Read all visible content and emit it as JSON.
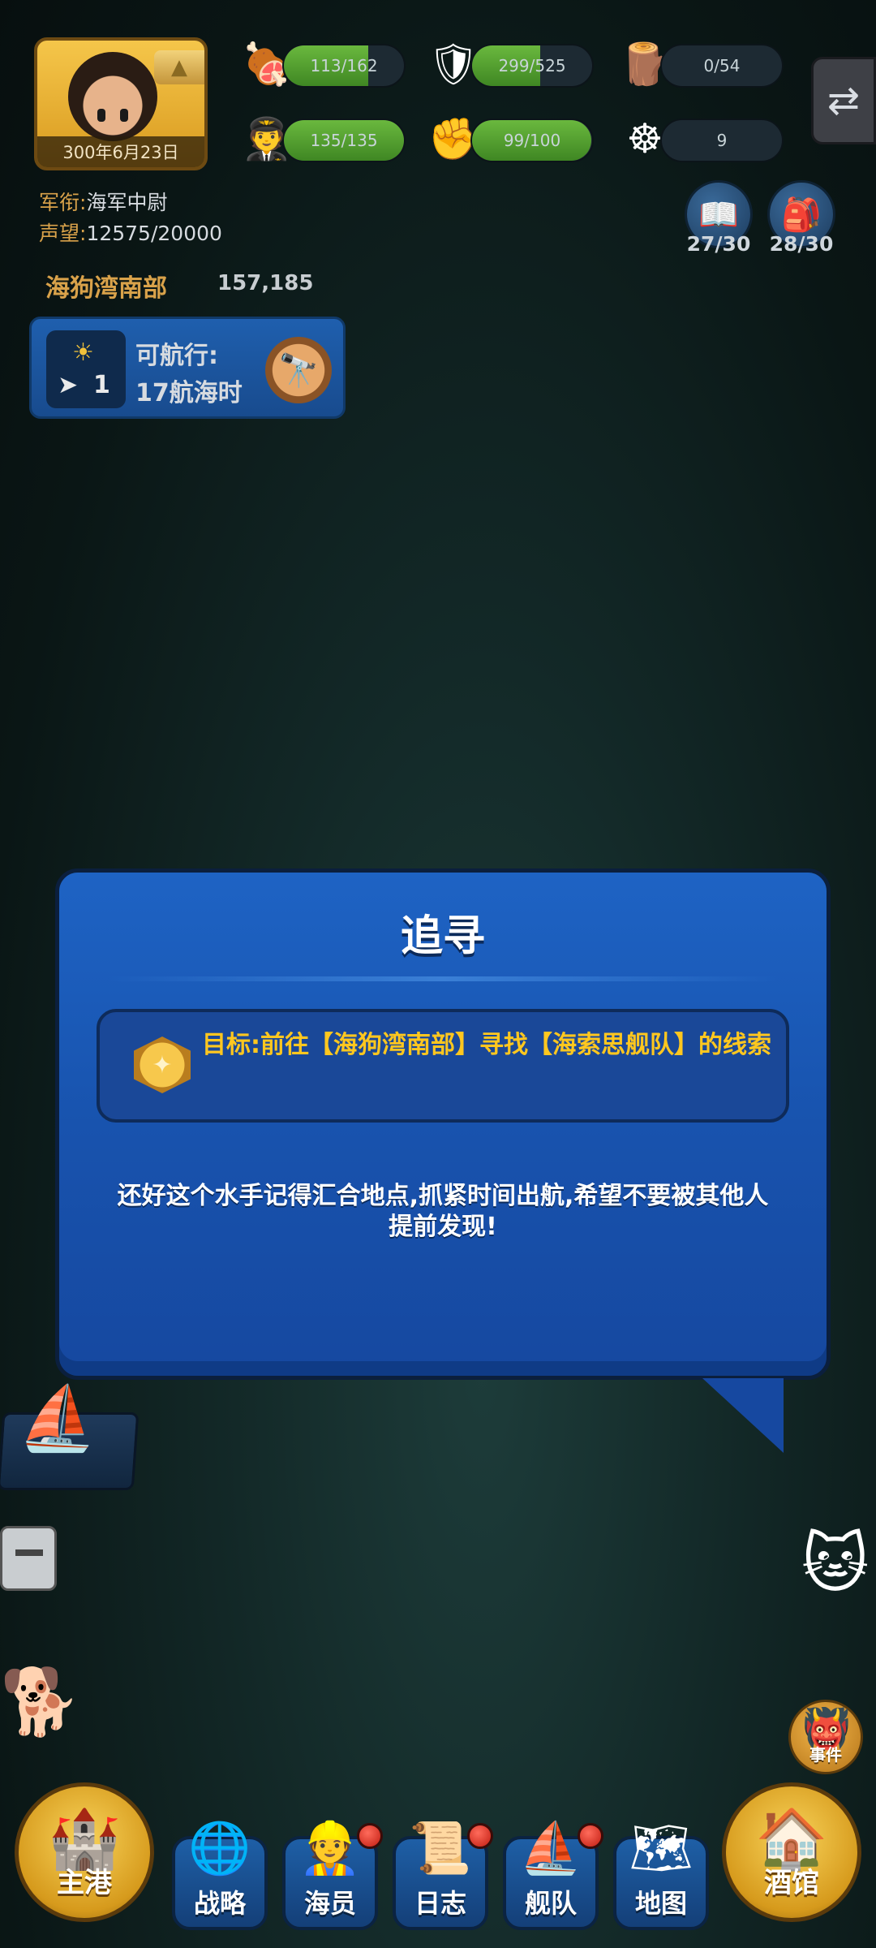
{
  "player": {
    "date": "300年6月23日",
    "rank_label": "军衔:",
    "rank_value": "海军中尉",
    "fame_label": "声望:",
    "fame_value": "12575/20000"
  },
  "resources": {
    "food": {
      "text": "113/162",
      "fill": 0.7,
      "icon": "meat-icon"
    },
    "armor": {
      "text": "299/525",
      "fill": 0.57,
      "icon": "shield-icon"
    },
    "wood": {
      "text": "0/54",
      "fill": 0.0,
      "icon": "lumber-icon"
    },
    "crew": {
      "text": "135/135",
      "fill": 1.0,
      "icon": "sailor-icon"
    },
    "morale": {
      "text": "99/100",
      "fill": 0.99,
      "icon": "fist-badge-icon"
    },
    "helm": {
      "text": "9",
      "fill": 0.0,
      "icon": "ship-wheel-icon"
    }
  },
  "location": {
    "name": "海狗湾南部",
    "value": "157,185"
  },
  "sailing": {
    "count": "1",
    "line1": "可航行:",
    "line2": "17航海时"
  },
  "side_counters": {
    "book": "27/30",
    "bag": "28/30"
  },
  "dialog": {
    "title": "追寻",
    "objective": "目标:前往【海狗湾南部】寻找【海索思舰队】的线索",
    "body": "还好这个水手记得汇合地点,抓紧时间出航,希望不要被其他人提前发现!"
  },
  "event_label": "事件",
  "nav": {
    "home": "主港",
    "strategy": "战略",
    "crew": "海员",
    "log": "日志",
    "fleet": "舰队",
    "map": "地图",
    "tavern": "酒馆"
  },
  "colors": {
    "dialog_blue": "#1853ae",
    "objective_yellow": "#ffc71f",
    "bar_green": "#4f9c2e",
    "label_gold": "#d9a24a"
  }
}
